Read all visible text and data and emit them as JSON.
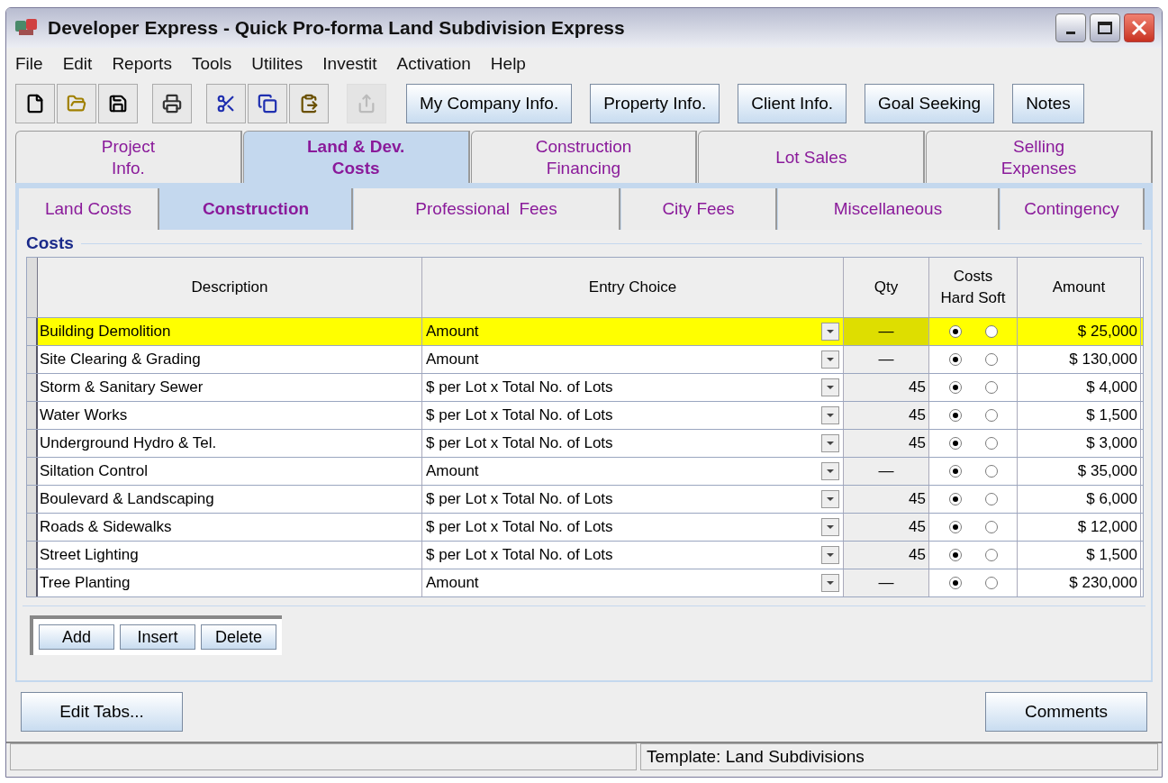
{
  "window": {
    "title": "Developer Express - Quick Pro-forma Land Subdivision Express"
  },
  "menu": [
    "File",
    "Edit",
    "Reports",
    "Tools",
    "Utilites",
    "Investit",
    "Activation",
    "Help"
  ],
  "toolbar_icons": [
    {
      "kind": "new",
      "disabled": false
    },
    {
      "kind": "open",
      "disabled": false
    },
    {
      "kind": "save",
      "disabled": false
    },
    {
      "kind": "print",
      "disabled": false
    },
    {
      "kind": "cut",
      "disabled": false
    },
    {
      "kind": "copy",
      "disabled": false
    },
    {
      "kind": "paste",
      "disabled": false
    },
    {
      "kind": "export",
      "disabled": true
    }
  ],
  "toolbar_buttons": [
    "My Company Info.",
    "Property Info.",
    "Client Info.",
    "Goal Seeking",
    "Notes"
  ],
  "main_tabs": [
    {
      "label": "Project\nInfo.",
      "selected": false
    },
    {
      "label": "Land & Dev.\nCosts",
      "selected": true
    },
    {
      "label": "Construction\nFinancing",
      "selected": false
    },
    {
      "label": "Lot Sales",
      "selected": false
    },
    {
      "label": "Selling\nExpenses",
      "selected": false
    }
  ],
  "sub_tabs": [
    {
      "label": "Land Costs",
      "selected": false
    },
    {
      "label": "Construction",
      "selected": true
    },
    {
      "label": "Professional  Fees",
      "selected": false
    },
    {
      "label": "City Fees",
      "selected": false
    },
    {
      "label": "Miscellaneous",
      "selected": false
    },
    {
      "label": "Contingency",
      "selected": false
    }
  ],
  "costs": {
    "title": "Costs",
    "columns": [
      "Description",
      "Entry Choice",
      "Qty",
      "Costs\nHard Soft",
      "Amount"
    ],
    "rows": [
      {
        "description": "Building Demolition",
        "entry_choice": "Amount",
        "qty": "—",
        "hard": true,
        "amount": "$ 25,000",
        "selected": true
      },
      {
        "description": "Site Clearing & Grading",
        "entry_choice": "Amount",
        "qty": "—",
        "hard": true,
        "amount": "$ 130,000",
        "selected": false
      },
      {
        "description": "Storm & Sanitary Sewer",
        "entry_choice": "$ per Lot x Total No. of Lots",
        "qty": "45",
        "hard": true,
        "amount": "$ 4,000",
        "selected": false
      },
      {
        "description": "Water Works",
        "entry_choice": "$ per Lot x Total No. of Lots",
        "qty": "45",
        "hard": true,
        "amount": "$ 1,500",
        "selected": false
      },
      {
        "description": "Underground Hydro & Tel.",
        "entry_choice": "$ per Lot x Total No. of Lots",
        "qty": "45",
        "hard": true,
        "amount": "$ 3,000",
        "selected": false
      },
      {
        "description": "Siltation Control",
        "entry_choice": "Amount",
        "qty": "—",
        "hard": true,
        "amount": "$ 35,000",
        "selected": false
      },
      {
        "description": "Boulevard & Landscaping",
        "entry_choice": "$ per Lot x Total No. of Lots",
        "qty": "45",
        "hard": true,
        "amount": "$ 6,000",
        "selected": false
      },
      {
        "description": "Roads & Sidewalks",
        "entry_choice": "$ per Lot x Total No. of Lots",
        "qty": "45",
        "hard": true,
        "amount": "$ 12,000",
        "selected": false
      },
      {
        "description": "Street Lighting",
        "entry_choice": "$ per Lot x Total No. of Lots",
        "qty": "45",
        "hard": true,
        "amount": "$ 1,500",
        "selected": false
      },
      {
        "description": "Tree Planting",
        "entry_choice": "Amount",
        "qty": "—",
        "hard": true,
        "amount": "$ 230,000",
        "selected": false
      }
    ],
    "row_buttons": [
      "Add",
      "Insert",
      "Delete"
    ]
  },
  "footer_buttons": [
    "Edit Tabs...",
    "Comments"
  ],
  "status_bar": {
    "template": "Template: Land Subdivisions"
  }
}
